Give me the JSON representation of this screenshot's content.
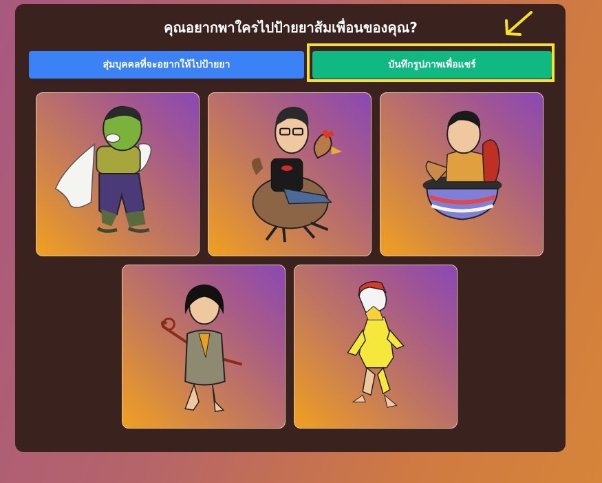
{
  "title": "คุณอยากพาใครไปป้ายยาส้มเพื่อนของคุณ?",
  "buttons": {
    "random_label": "สุ่มบุคคลที่จะอยากให้ไปป้ายยา",
    "save_label": "บันทึกรูปภาพเพื่อแชร์"
  },
  "colors": {
    "panel": "#3a221e",
    "random_button": "#3b82f6",
    "save_button": "#10b981",
    "highlight": "#f7e324"
  },
  "cards": [
    {
      "icon": "green-caped-character-illustration"
    },
    {
      "icon": "man-riding-rooster-illustration"
    },
    {
      "icon": "man-in-bowl-illustration"
    },
    {
      "icon": "woman-with-staff-illustration"
    },
    {
      "icon": "yellow-costume-character-illustration"
    }
  ]
}
